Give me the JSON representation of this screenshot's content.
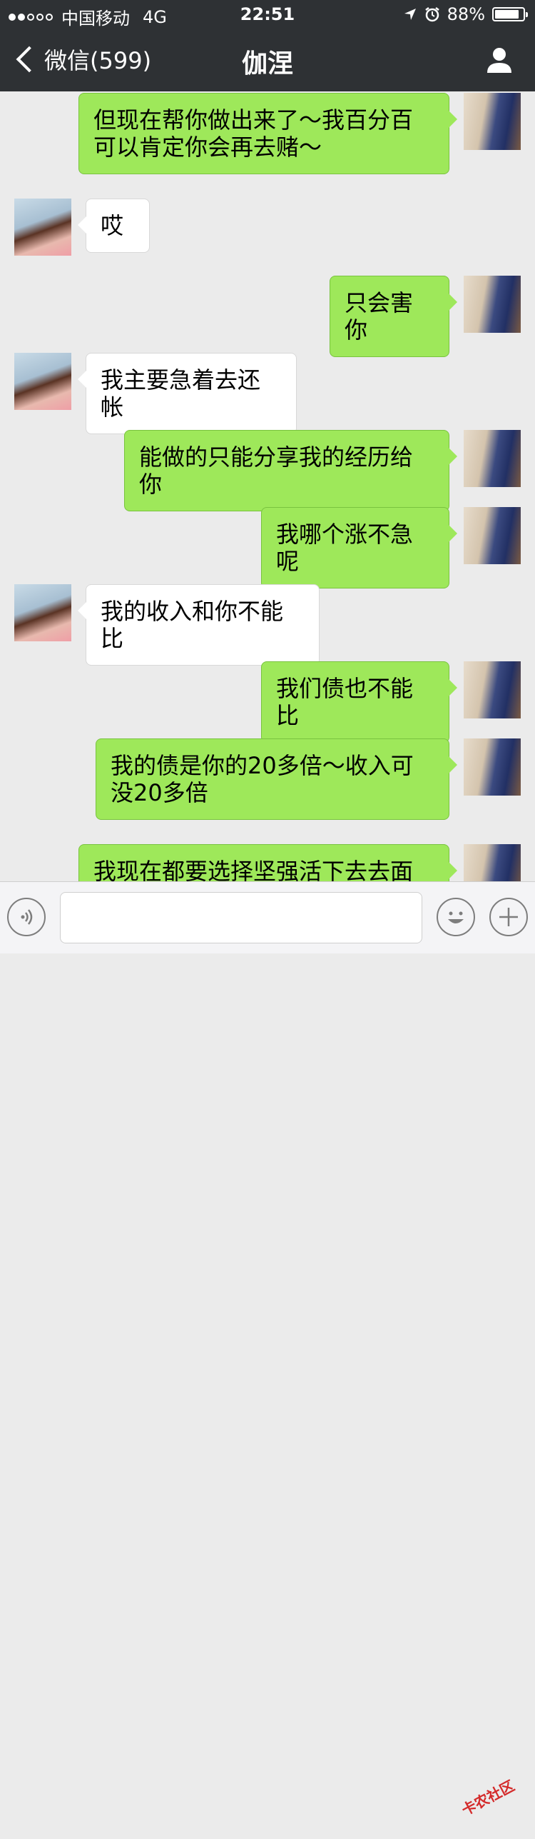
{
  "status": {
    "carrier": "中国移动",
    "network": "4G",
    "time": "22:51",
    "battery": "88%",
    "battery_level": 0.88
  },
  "nav": {
    "back_label": "微信(599)",
    "title": "伽涅"
  },
  "messages": [
    {
      "from": "me",
      "text": "但现在帮你做出来了～我百分百可以肯定你会再去赌～"
    },
    {
      "from": "her",
      "text": "哎"
    },
    {
      "from": "me",
      "text": "只会害你"
    },
    {
      "from": "her",
      "text": "我主要急着去还帐"
    },
    {
      "from": "me",
      "text": "能做的只能分享我的经历给你"
    },
    {
      "from": "me",
      "text": "我哪个涨不急呢"
    },
    {
      "from": "her",
      "text": "我的收入和你不能比"
    },
    {
      "from": "me",
      "text": "我们债也不能比"
    },
    {
      "from": "me",
      "text": "我的债是你的20多倍～收入可没20多倍"
    },
    {
      "from": "me",
      "text": "我现在都要选择坚强活下去去面对"
    }
  ],
  "watermark": "卡农社区",
  "colors": {
    "header_bg": "#2e3134",
    "chat_bg": "#ebebeb",
    "my_bubble": "#9ee85a",
    "her_bubble": "#ffffff"
  },
  "icons": {
    "back": "chevron-left-icon",
    "profile": "person-icon",
    "voice": "voice-icon",
    "emoji": "emoji-icon",
    "more": "plus-icon",
    "location": "location-arrow-icon",
    "alarm": "alarm-icon"
  }
}
